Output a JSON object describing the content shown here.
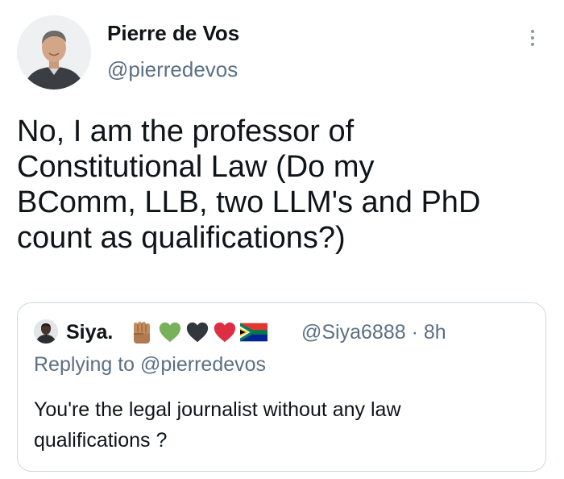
{
  "author": {
    "name": "Pierre de Vos",
    "handle": "@pierredevos"
  },
  "tweet": {
    "lines": [
      "No, I am the professor of",
      "Constitutional Law (Do my",
      "BComm, LLB, two LLM's and PhD",
      "count as qualifications?)"
    ]
  },
  "quoted_tweet": {
    "name": "Siya.",
    "emojis": [
      "raised-fist-icon",
      "green-heart-icon",
      "black-heart-icon",
      "red-heart-icon",
      "south-africa-flag-icon"
    ],
    "handle_time": "@Siya6888 · 8h",
    "replying_to": "Replying to @pierredevos",
    "lines": [
      "You're the legal journalist without any law",
      "qualifications ?"
    ]
  },
  "colors": {
    "text": "#0f1419",
    "secondary": "#5b7083",
    "border": "#cfd9de",
    "green_heart": "#78b159",
    "black_heart": "#31373d",
    "red_heart": "#dd2e44",
    "fist": "#b07b50"
  }
}
